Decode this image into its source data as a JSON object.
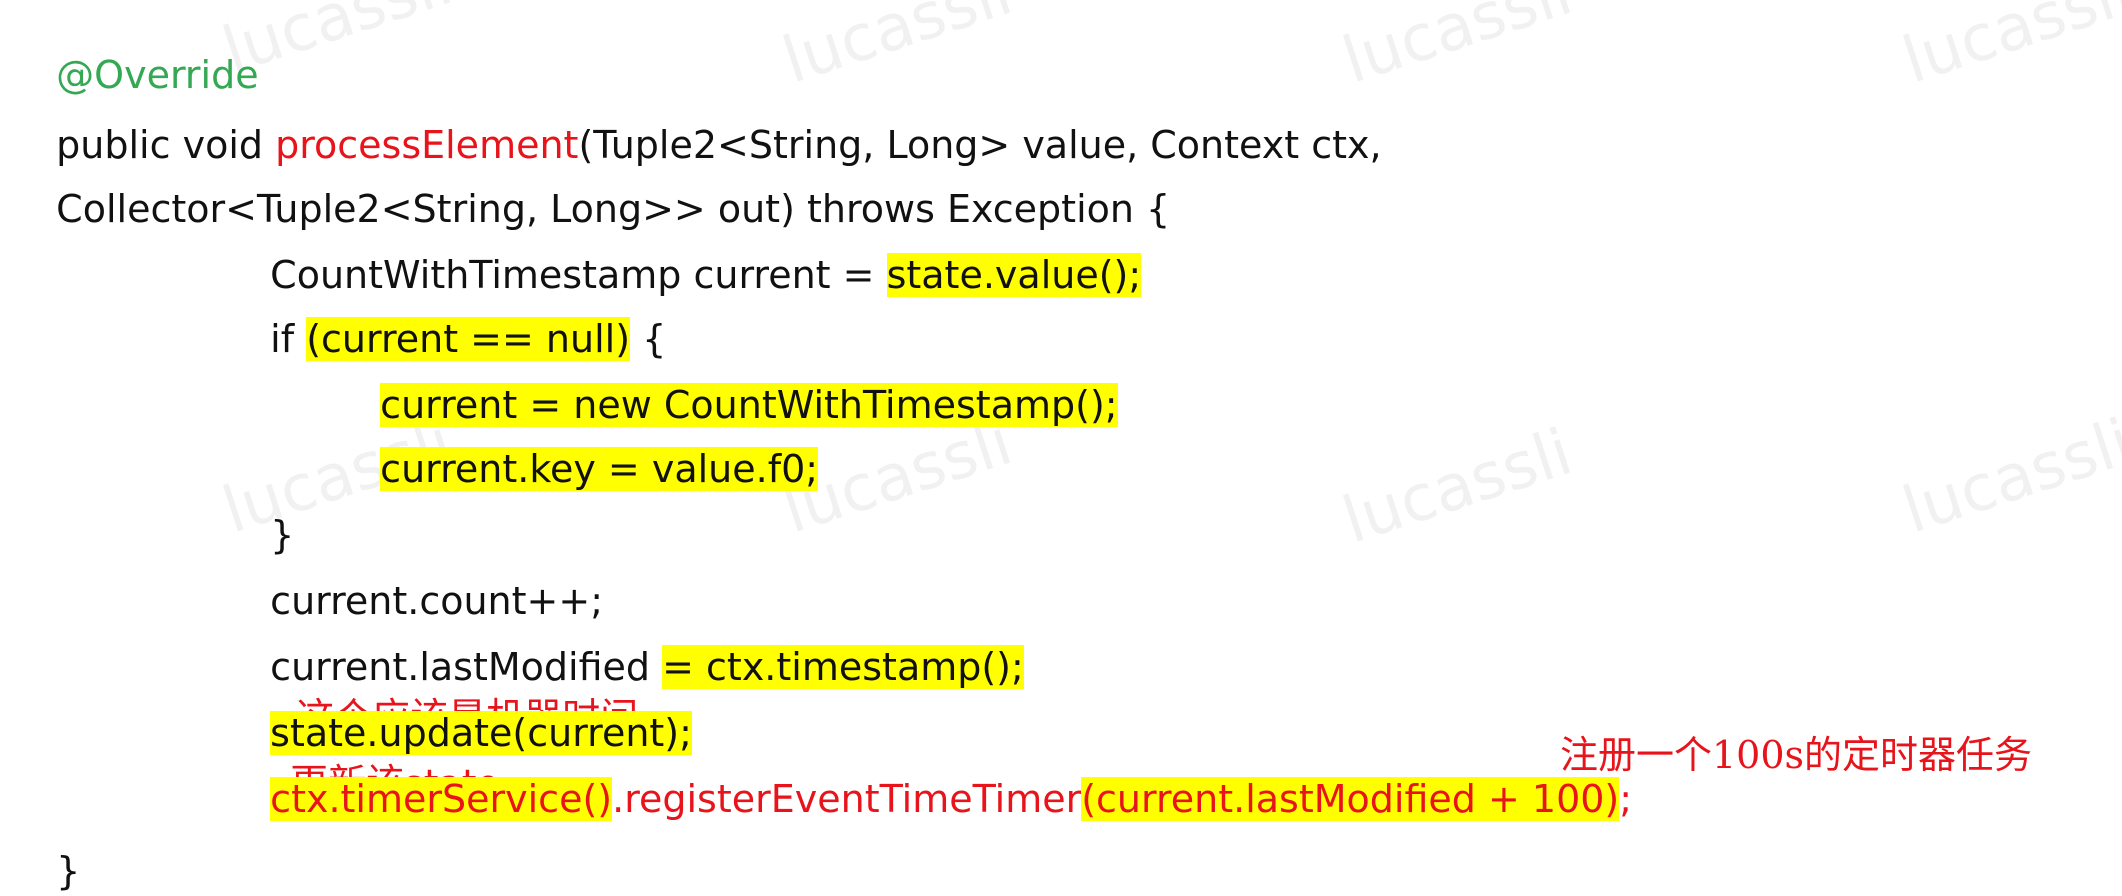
{
  "watermark_text": "lucassli",
  "code": {
    "line1": "@Override",
    "line2_a": "public void ",
    "line2_b": "processElement",
    "line2_c": "(Tuple2<String, Long> value, Context ctx,",
    "line3": "Collector<Tuple2<String, Long>> out) throws Exception {",
    "line4_a": "CountWithTimestamp current = ",
    "line4_b": "state.value();",
    "line5_a": "if ",
    "line5_b": "(current == null)",
    "line5_c": " {",
    "line6": "current = new CountWithTimestamp();",
    "line7": "current.key = value.f0;",
    "line8": "}",
    "line9": "current.count++;",
    "line10_a": "current.lastModified ",
    "line10_b": "= ctx.timestamp();",
    "line11": "state.update(current);",
    "line12_a": "ctx.timerService()",
    "line12_b": ".registerEventTimeTimer",
    "line12_c": "(current.lastModified + 100)",
    "line12_d": ";",
    "line13": "}"
  },
  "annotations": {
    "machine_time": "这个应该是机器时间",
    "update_state": "更新该state",
    "register_timer": "注册一个100s的定时器任务"
  },
  "colors": {
    "highlight": "#ffff00",
    "keyword_red": "#e8141b",
    "annotation_green": "#34a853"
  }
}
